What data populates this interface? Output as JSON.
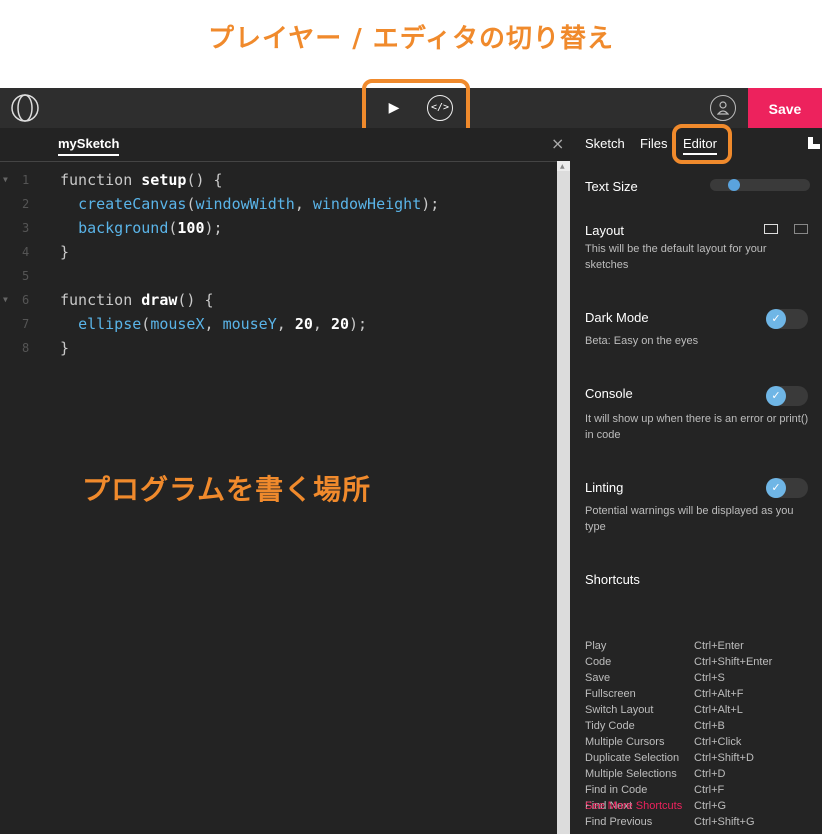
{
  "captions": {
    "top": "プレイヤー / エディタの切り替え",
    "middle": "プログラムを書く場所"
  },
  "topbar": {
    "play_icon": "play-icon",
    "code_icon": "code-icon",
    "avatar_icon": "user-icon",
    "save_label": "Save",
    "accent_color": "#ed225d"
  },
  "editor": {
    "file_tab": "mySketch",
    "close_label": "×",
    "line_numbers": [
      "1",
      "2",
      "3",
      "4",
      "5",
      "6",
      "7",
      "8"
    ],
    "code_lines": [
      "function setup() {",
      "  createCanvas(windowWidth, windowHeight);",
      "  background(100);",
      "}",
      "",
      "function draw() {",
      "  ellipse(mouseX, mouseY, 20, 20);",
      "}"
    ]
  },
  "settings": {
    "tabs": [
      "Sketch",
      "Files",
      "Editor"
    ],
    "active_tab": "Editor",
    "text_size": {
      "label": "Text Size",
      "level": 0.2
    },
    "layout": {
      "label": "Layout",
      "desc": "This will be the default layout for your sketches"
    },
    "dark_mode": {
      "label": "Dark Mode",
      "desc": "Beta: Easy on the eyes",
      "on": true
    },
    "console": {
      "label": "Console",
      "desc": "It will show up when there is an error or print() in code",
      "on": true
    },
    "linting": {
      "label": "Linting",
      "desc": "Potential warnings will be displayed as you type",
      "on": true
    },
    "shortcuts_title": "Shortcuts",
    "shortcuts": [
      {
        "action": "Play",
        "keys": "Ctrl+Enter"
      },
      {
        "action": "Code",
        "keys": "Ctrl+Shift+Enter"
      },
      {
        "action": "Save",
        "keys": "Ctrl+S"
      },
      {
        "action": "Fullscreen",
        "keys": "Ctrl+Alt+F"
      },
      {
        "action": "Switch Layout",
        "keys": "Ctrl+Alt+L"
      },
      {
        "action": "Tidy Code",
        "keys": "Ctrl+B"
      },
      {
        "action": "Multiple Cursors",
        "keys": "Ctrl+Click"
      },
      {
        "action": "Duplicate Selection",
        "keys": "Ctrl+Shift+D"
      },
      {
        "action": "Multiple Selections",
        "keys": "Ctrl+D"
      },
      {
        "action": "Find in Code",
        "keys": "Ctrl+F"
      },
      {
        "action": "Find Next",
        "keys": "Ctrl+G"
      },
      {
        "action": "Find Previous",
        "keys": "Ctrl+Shift+G"
      }
    ],
    "more_link": "See More Shortcuts"
  }
}
